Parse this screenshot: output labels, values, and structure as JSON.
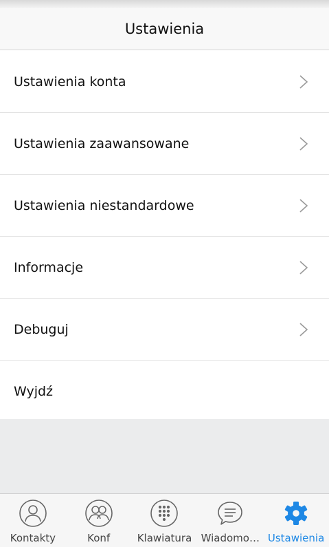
{
  "header": {
    "title": "Ustawienia"
  },
  "menu": {
    "items": [
      {
        "label": "Ustawienia konta"
      },
      {
        "label": "Ustawienia zaawansowane"
      },
      {
        "label": "Ustawienia niestandardowe"
      },
      {
        "label": "Informacje"
      },
      {
        "label": "Debuguj"
      },
      {
        "label": "Wyjdź"
      }
    ]
  },
  "tabbar": {
    "tabs": [
      {
        "label": "Kontakty",
        "icon": "person-icon"
      },
      {
        "label": "Konf",
        "icon": "group-icon"
      },
      {
        "label": "Klawiatura",
        "icon": "dialpad-icon"
      },
      {
        "label": "Wiadomo…",
        "icon": "chat-bubble-icon"
      },
      {
        "label": "Ustawienia",
        "icon": "gear-icon",
        "active": true
      }
    ]
  },
  "colors": {
    "accent": "#1e88e5",
    "icon_gray": "#666666",
    "filler": "#ebeced"
  }
}
